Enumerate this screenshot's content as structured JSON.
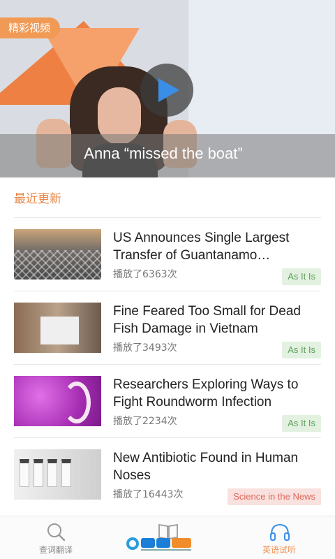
{
  "banner": {
    "tag": "精彩视频",
    "caption": "Anna “missed the boat”"
  },
  "section": {
    "title": "最近更新"
  },
  "news": [
    {
      "title": "US Announces Single Largest Transfer of Guantanamo…",
      "plays": "播放了6363次",
      "category": "As It Is",
      "category_color": "#5ba05a"
    },
    {
      "title": "Fine Feared Too Small for Dead Fish Damage in Vietnam",
      "plays": "播放了3493次",
      "category": "As It Is",
      "category_color": "#5ba05a"
    },
    {
      "title": "Researchers Exploring Ways to Fight Roundworm Infection",
      "plays": "播放了2234次",
      "category": "As It Is",
      "category_color": "#5ba05a"
    },
    {
      "title": "New Antibiotic Found in Human Noses",
      "plays": "播放了16443次",
      "category": "Science in the News",
      "category_color": "#e0685a"
    }
  ],
  "bottom_nav": {
    "items": [
      {
        "label": "查词翻译",
        "icon": "search-icon"
      },
      {
        "label": "",
        "icon": "book-icon"
      },
      {
        "label": "英语试听",
        "icon": "headphones-icon"
      }
    ]
  },
  "colors": {
    "accent": "#f08d4f",
    "tag_bg": "#f19a55"
  }
}
